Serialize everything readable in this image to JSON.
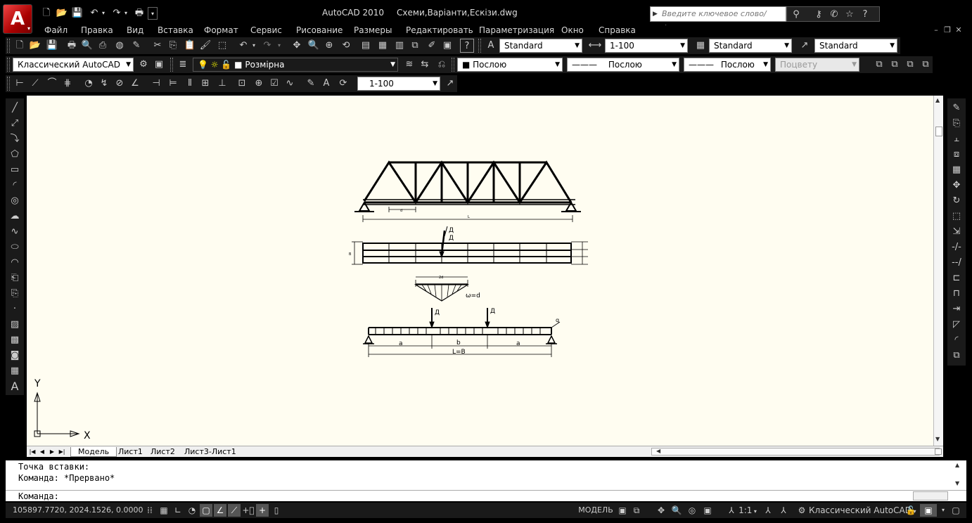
{
  "window": {
    "title": "AutoCAD 2010",
    "file": "Схеми,Варіанти,Ескізи.dwg",
    "search_placeholder": "Введите ключевое слово/фразу"
  },
  "menu": [
    "Файл",
    "Правка",
    "Вид",
    "Вставка",
    "Формат",
    "Сервис",
    "Рисование",
    "Размеры",
    "Редактировать",
    "Параметризация",
    "Окно",
    "Справка"
  ],
  "toolbars": {
    "text_style": "Standard",
    "dim_scale": "1-100",
    "table_style": "Standard",
    "multileader_style": "Standard",
    "workspace": "Классический AutoCAD",
    "layer": "Розмірна",
    "color": "Послою",
    "linetype": "Послою",
    "lineweight": "Послою",
    "plot_style": "Поцвету",
    "dim_scale_2": "1-100"
  },
  "drawing": {
    "truss_panel_label": "d",
    "truss_span_label": "L",
    "load_label_1": "Д",
    "load_label_2": "Д",
    "width_label": "B",
    "influence_width_label": "2d",
    "influence_area_label": "ω=d",
    "beam_load_1": "Д",
    "beam_load_2": "Д",
    "distributed_label": "q",
    "segment_a1": "a",
    "segment_b": "b",
    "segment_a2": "a",
    "beam_span_label": "L=B"
  },
  "ucs": {
    "y": "Y",
    "x": "X"
  },
  "tabs": [
    "Модель",
    "Лист1",
    "Лист2",
    "Лист3-Лист1"
  ],
  "command": {
    "line1": "Точка вставки:",
    "line2": "Команда: *Прервано*",
    "prompt": "Команда:"
  },
  "status": {
    "coordinates": "105897.7720, 2024.1526, 0.0000",
    "model_label": "МОДЕЛЬ",
    "annotation_scale": "1:1",
    "workspace": "Классический AutoCAD"
  }
}
